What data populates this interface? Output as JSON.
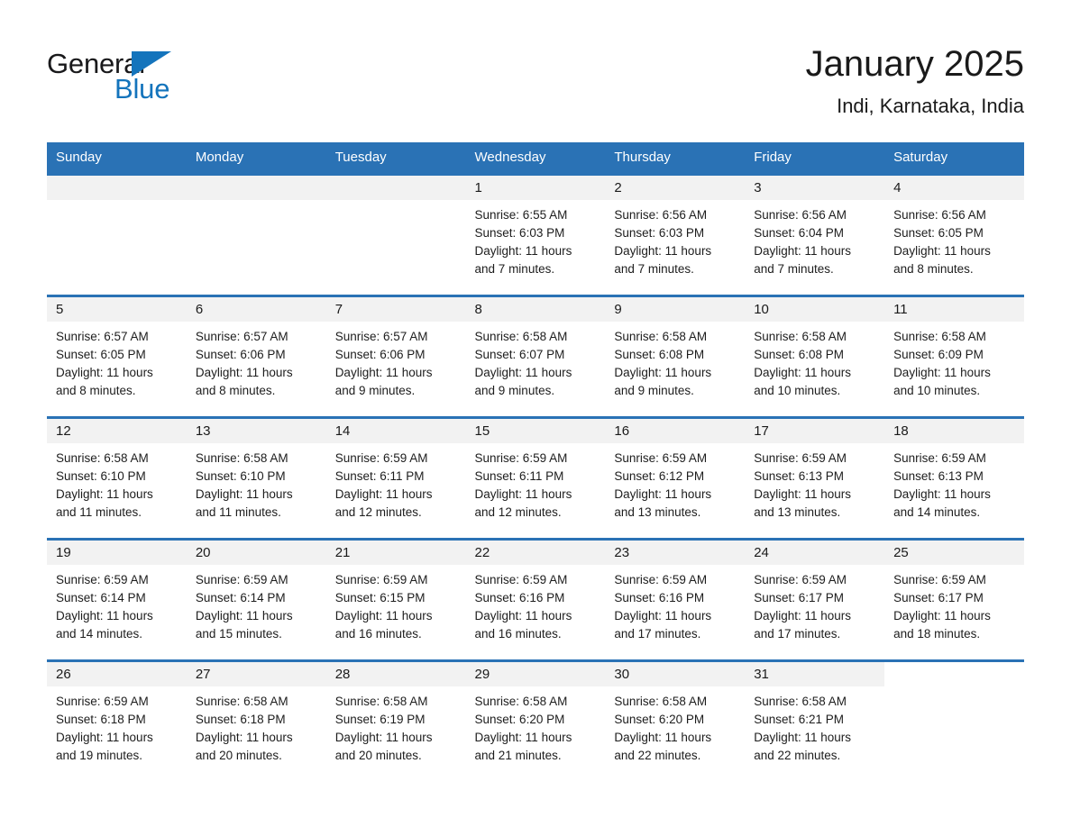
{
  "brand": {
    "name_part1": "General",
    "name_part2": "Blue",
    "triangle_icon": "blue-triangle-icon",
    "accent_color": "#1474bc"
  },
  "header": {
    "month_title": "January 2025",
    "location": "Indi, Karnataka, India"
  },
  "theme": {
    "header_blue": "#2a72b5",
    "row_rule_blue": "#2a72b5",
    "daynum_band": "#f2f2f2",
    "text": "#1a1a1a"
  },
  "weekday_headers": [
    "Sunday",
    "Monday",
    "Tuesday",
    "Wednesday",
    "Thursday",
    "Friday",
    "Saturday"
  ],
  "labels": {
    "sunrise_prefix": "Sunrise:",
    "sunset_prefix": "Sunset:",
    "daylight_prefix": "Daylight:"
  },
  "weeks": [
    [
      {
        "day": "",
        "empty": true
      },
      {
        "day": "",
        "empty": true
      },
      {
        "day": "",
        "empty": true
      },
      {
        "day": "1",
        "sunrise": "Sunrise: 6:55 AM",
        "sunset": "Sunset: 6:03 PM",
        "daylight_l1": "Daylight: 11 hours",
        "daylight_l2": "and 7 minutes."
      },
      {
        "day": "2",
        "sunrise": "Sunrise: 6:56 AM",
        "sunset": "Sunset: 6:03 PM",
        "daylight_l1": "Daylight: 11 hours",
        "daylight_l2": "and 7 minutes."
      },
      {
        "day": "3",
        "sunrise": "Sunrise: 6:56 AM",
        "sunset": "Sunset: 6:04 PM",
        "daylight_l1": "Daylight: 11 hours",
        "daylight_l2": "and 7 minutes."
      },
      {
        "day": "4",
        "sunrise": "Sunrise: 6:56 AM",
        "sunset": "Sunset: 6:05 PM",
        "daylight_l1": "Daylight: 11 hours",
        "daylight_l2": "and 8 minutes."
      }
    ],
    [
      {
        "day": "5",
        "sunrise": "Sunrise: 6:57 AM",
        "sunset": "Sunset: 6:05 PM",
        "daylight_l1": "Daylight: 11 hours",
        "daylight_l2": "and 8 minutes."
      },
      {
        "day": "6",
        "sunrise": "Sunrise: 6:57 AM",
        "sunset": "Sunset: 6:06 PM",
        "daylight_l1": "Daylight: 11 hours",
        "daylight_l2": "and 8 minutes."
      },
      {
        "day": "7",
        "sunrise": "Sunrise: 6:57 AM",
        "sunset": "Sunset: 6:06 PM",
        "daylight_l1": "Daylight: 11 hours",
        "daylight_l2": "and 9 minutes."
      },
      {
        "day": "8",
        "sunrise": "Sunrise: 6:58 AM",
        "sunset": "Sunset: 6:07 PM",
        "daylight_l1": "Daylight: 11 hours",
        "daylight_l2": "and 9 minutes."
      },
      {
        "day": "9",
        "sunrise": "Sunrise: 6:58 AM",
        "sunset": "Sunset: 6:08 PM",
        "daylight_l1": "Daylight: 11 hours",
        "daylight_l2": "and 9 minutes."
      },
      {
        "day": "10",
        "sunrise": "Sunrise: 6:58 AM",
        "sunset": "Sunset: 6:08 PM",
        "daylight_l1": "Daylight: 11 hours",
        "daylight_l2": "and 10 minutes."
      },
      {
        "day": "11",
        "sunrise": "Sunrise: 6:58 AM",
        "sunset": "Sunset: 6:09 PM",
        "daylight_l1": "Daylight: 11 hours",
        "daylight_l2": "and 10 minutes."
      }
    ],
    [
      {
        "day": "12",
        "sunrise": "Sunrise: 6:58 AM",
        "sunset": "Sunset: 6:10 PM",
        "daylight_l1": "Daylight: 11 hours",
        "daylight_l2": "and 11 minutes."
      },
      {
        "day": "13",
        "sunrise": "Sunrise: 6:58 AM",
        "sunset": "Sunset: 6:10 PM",
        "daylight_l1": "Daylight: 11 hours",
        "daylight_l2": "and 11 minutes."
      },
      {
        "day": "14",
        "sunrise": "Sunrise: 6:59 AM",
        "sunset": "Sunset: 6:11 PM",
        "daylight_l1": "Daylight: 11 hours",
        "daylight_l2": "and 12 minutes."
      },
      {
        "day": "15",
        "sunrise": "Sunrise: 6:59 AM",
        "sunset": "Sunset: 6:11 PM",
        "daylight_l1": "Daylight: 11 hours",
        "daylight_l2": "and 12 minutes."
      },
      {
        "day": "16",
        "sunrise": "Sunrise: 6:59 AM",
        "sunset": "Sunset: 6:12 PM",
        "daylight_l1": "Daylight: 11 hours",
        "daylight_l2": "and 13 minutes."
      },
      {
        "day": "17",
        "sunrise": "Sunrise: 6:59 AM",
        "sunset": "Sunset: 6:13 PM",
        "daylight_l1": "Daylight: 11 hours",
        "daylight_l2": "and 13 minutes."
      },
      {
        "day": "18",
        "sunrise": "Sunrise: 6:59 AM",
        "sunset": "Sunset: 6:13 PM",
        "daylight_l1": "Daylight: 11 hours",
        "daylight_l2": "and 14 minutes."
      }
    ],
    [
      {
        "day": "19",
        "sunrise": "Sunrise: 6:59 AM",
        "sunset": "Sunset: 6:14 PM",
        "daylight_l1": "Daylight: 11 hours",
        "daylight_l2": "and 14 minutes."
      },
      {
        "day": "20",
        "sunrise": "Sunrise: 6:59 AM",
        "sunset": "Sunset: 6:14 PM",
        "daylight_l1": "Daylight: 11 hours",
        "daylight_l2": "and 15 minutes."
      },
      {
        "day": "21",
        "sunrise": "Sunrise: 6:59 AM",
        "sunset": "Sunset: 6:15 PM",
        "daylight_l1": "Daylight: 11 hours",
        "daylight_l2": "and 16 minutes."
      },
      {
        "day": "22",
        "sunrise": "Sunrise: 6:59 AM",
        "sunset": "Sunset: 6:16 PM",
        "daylight_l1": "Daylight: 11 hours",
        "daylight_l2": "and 16 minutes."
      },
      {
        "day": "23",
        "sunrise": "Sunrise: 6:59 AM",
        "sunset": "Sunset: 6:16 PM",
        "daylight_l1": "Daylight: 11 hours",
        "daylight_l2": "and 17 minutes."
      },
      {
        "day": "24",
        "sunrise": "Sunrise: 6:59 AM",
        "sunset": "Sunset: 6:17 PM",
        "daylight_l1": "Daylight: 11 hours",
        "daylight_l2": "and 17 minutes."
      },
      {
        "day": "25",
        "sunrise": "Sunrise: 6:59 AM",
        "sunset": "Sunset: 6:17 PM",
        "daylight_l1": "Daylight: 11 hours",
        "daylight_l2": "and 18 minutes."
      }
    ],
    [
      {
        "day": "26",
        "sunrise": "Sunrise: 6:59 AM",
        "sunset": "Sunset: 6:18 PM",
        "daylight_l1": "Daylight: 11 hours",
        "daylight_l2": "and 19 minutes."
      },
      {
        "day": "27",
        "sunrise": "Sunrise: 6:58 AM",
        "sunset": "Sunset: 6:18 PM",
        "daylight_l1": "Daylight: 11 hours",
        "daylight_l2": "and 20 minutes."
      },
      {
        "day": "28",
        "sunrise": "Sunrise: 6:58 AM",
        "sunset": "Sunset: 6:19 PM",
        "daylight_l1": "Daylight: 11 hours",
        "daylight_l2": "and 20 minutes."
      },
      {
        "day": "29",
        "sunrise": "Sunrise: 6:58 AM",
        "sunset": "Sunset: 6:20 PM",
        "daylight_l1": "Daylight: 11 hours",
        "daylight_l2": "and 21 minutes."
      },
      {
        "day": "30",
        "sunrise": "Sunrise: 6:58 AM",
        "sunset": "Sunset: 6:20 PM",
        "daylight_l1": "Daylight: 11 hours",
        "daylight_l2": "and 22 minutes."
      },
      {
        "day": "31",
        "sunrise": "Sunrise: 6:58 AM",
        "sunset": "Sunset: 6:21 PM",
        "daylight_l1": "Daylight: 11 hours",
        "daylight_l2": "and 22 minutes."
      },
      {
        "day": "",
        "empty": true,
        "trailing": true
      }
    ]
  ]
}
